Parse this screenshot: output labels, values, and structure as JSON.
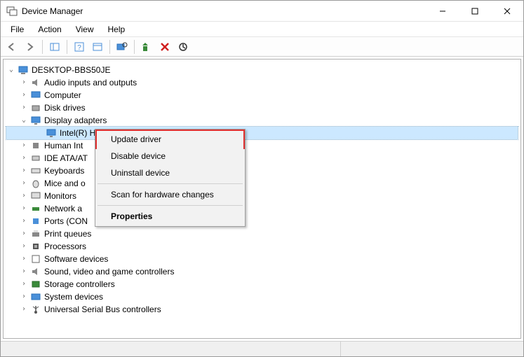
{
  "window": {
    "title": "Device Manager"
  },
  "menubar": {
    "items": [
      "File",
      "Action",
      "View",
      "Help"
    ]
  },
  "toolbar": {
    "icons": [
      "back-icon",
      "forward-icon",
      "|",
      "show-hide-tree-icon",
      "|",
      "help-icon",
      "properties-icon",
      "|",
      "scan-hardware-icon",
      "|",
      "update-driver-icon",
      "uninstall-icon",
      "disable-icon"
    ]
  },
  "tree": {
    "root": {
      "label": "DESKTOP-BBS50JE",
      "expanded": true
    },
    "categories": [
      {
        "label": "Audio inputs and outputs",
        "icon": "audio-icon",
        "expanded": false
      },
      {
        "label": "Computer",
        "icon": "computer-icon",
        "expanded": false
      },
      {
        "label": "Disk drives",
        "icon": "disk-icon",
        "expanded": false
      },
      {
        "label": "Display adapters",
        "icon": "display-icon",
        "expanded": true,
        "children": [
          {
            "label": "Intel(R) HD Graphics 4600",
            "icon": "display-icon",
            "selected": true
          }
        ]
      },
      {
        "label": "Human Interface Devices",
        "icon": "hid-icon",
        "expanded": false,
        "truncated": "Human Int"
      },
      {
        "label": "IDE ATA/ATAPI controllers",
        "icon": "ide-icon",
        "expanded": false,
        "truncated": "IDE ATA/AT"
      },
      {
        "label": "Keyboards",
        "icon": "keyboard-icon",
        "expanded": false,
        "truncated": "Keyboards"
      },
      {
        "label": "Mice and other pointing devices",
        "icon": "mouse-icon",
        "expanded": false,
        "truncated": "Mice and o"
      },
      {
        "label": "Monitors",
        "icon": "monitor-icon",
        "expanded": false,
        "truncated": "Monitors"
      },
      {
        "label": "Network adapters",
        "icon": "network-icon",
        "expanded": false,
        "truncated": "Network a"
      },
      {
        "label": "Ports (COM & LPT)",
        "icon": "port-icon",
        "expanded": false,
        "truncated": "Ports (CON"
      },
      {
        "label": "Print queues",
        "icon": "printer-icon",
        "expanded": false
      },
      {
        "label": "Processors",
        "icon": "cpu-icon",
        "expanded": false
      },
      {
        "label": "Software devices",
        "icon": "software-icon",
        "expanded": false
      },
      {
        "label": "Sound, video and game controllers",
        "icon": "sound-icon",
        "expanded": false
      },
      {
        "label": "Storage controllers",
        "icon": "storage-icon",
        "expanded": false
      },
      {
        "label": "System devices",
        "icon": "system-icon",
        "expanded": false
      },
      {
        "label": "Universal Serial Bus controllers",
        "icon": "usb-icon",
        "expanded": false
      }
    ]
  },
  "context_menu": {
    "items": [
      {
        "label": "Update driver",
        "highlighted": true
      },
      {
        "label": "Disable device"
      },
      {
        "label": "Uninstall device"
      },
      {
        "separator": true
      },
      {
        "label": "Scan for hardware changes"
      },
      {
        "separator": true
      },
      {
        "label": "Properties",
        "bold": true
      }
    ]
  }
}
